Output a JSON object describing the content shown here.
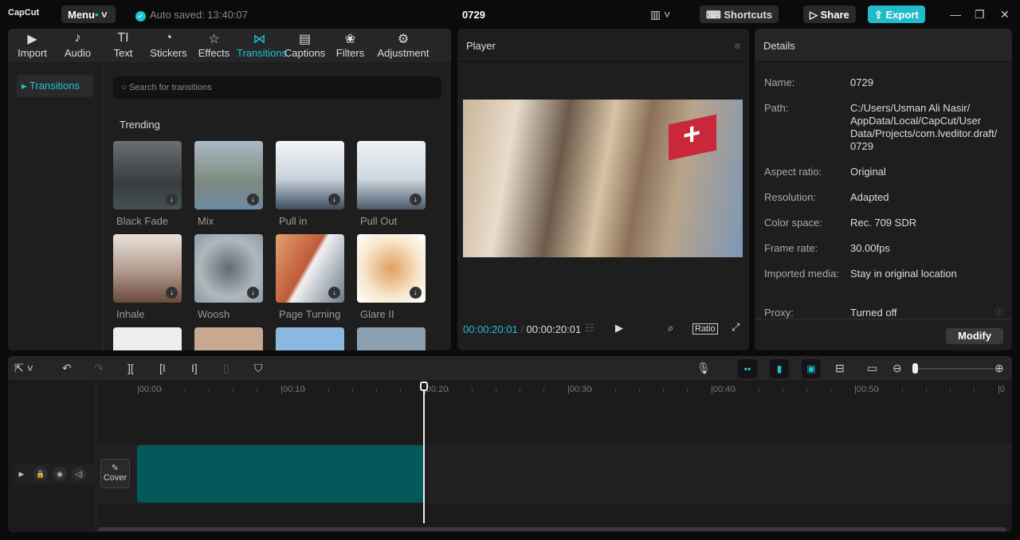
{
  "app": {
    "logo": "CapCut",
    "menu": "Menu",
    "autosave": "Auto saved: 13:40:07",
    "title": "0729",
    "shortcuts": "Shortcuts",
    "share": "Share",
    "export": "Export"
  },
  "tabs": [
    {
      "label": "Import",
      "icon": "▶"
    },
    {
      "label": "Audio",
      "icon": "♪"
    },
    {
      "label": "Text",
      "icon": "TI"
    },
    {
      "label": "Stickers",
      "icon": "◔"
    },
    {
      "label": "Effects",
      "icon": "☆"
    },
    {
      "label": "Transitions",
      "icon": "⋈"
    },
    {
      "label": "Captions",
      "icon": "▤"
    },
    {
      "label": "Filters",
      "icon": "❀"
    },
    {
      "label": "Adjustment",
      "icon": "⚙"
    }
  ],
  "sidebar": {
    "item": "Transitions"
  },
  "search": {
    "placeholder": "Search for transitions"
  },
  "section": "Trending",
  "transitions": [
    {
      "label": "Black Fade"
    },
    {
      "label": "Mix"
    },
    {
      "label": "Pull in"
    },
    {
      "label": "Pull Out"
    },
    {
      "label": "Inhale"
    },
    {
      "label": "Woosh"
    },
    {
      "label": "Page Turning"
    },
    {
      "label": "Glare II"
    }
  ],
  "player": {
    "title": "Player",
    "current": "00:00:20:01",
    "total": "00:00:20:01",
    "ratio": "Ratio"
  },
  "details": {
    "title": "Details",
    "rows": [
      {
        "k": "Name:",
        "v": "0729"
      },
      {
        "k": "Path:",
        "v": "C:/Users/Usman Ali Nasir/ AppData/Local/CapCut/User Data/Projects/com.lveditor.draft/ 0729"
      },
      {
        "k": "Aspect ratio:",
        "v": "Original"
      },
      {
        "k": "Resolution:",
        "v": "Adapted"
      },
      {
        "k": "Color space:",
        "v": "Rec. 709 SDR"
      },
      {
        "k": "Frame rate:",
        "v": "30.00fps"
      },
      {
        "k": "Imported media:",
        "v": "Stay in original location"
      },
      {
        "k": "Proxy:",
        "v": "Turned off"
      }
    ],
    "modify": "Modify"
  },
  "timeline": {
    "ticks": [
      "|00:00",
      "|00:10",
      "|00:20",
      "|00:30",
      "|00:40",
      "|00:50",
      "|0"
    ],
    "cover": "Cover"
  },
  "colors": {
    "accent": "#1fc4cf",
    "clip": "#045a5a"
  }
}
